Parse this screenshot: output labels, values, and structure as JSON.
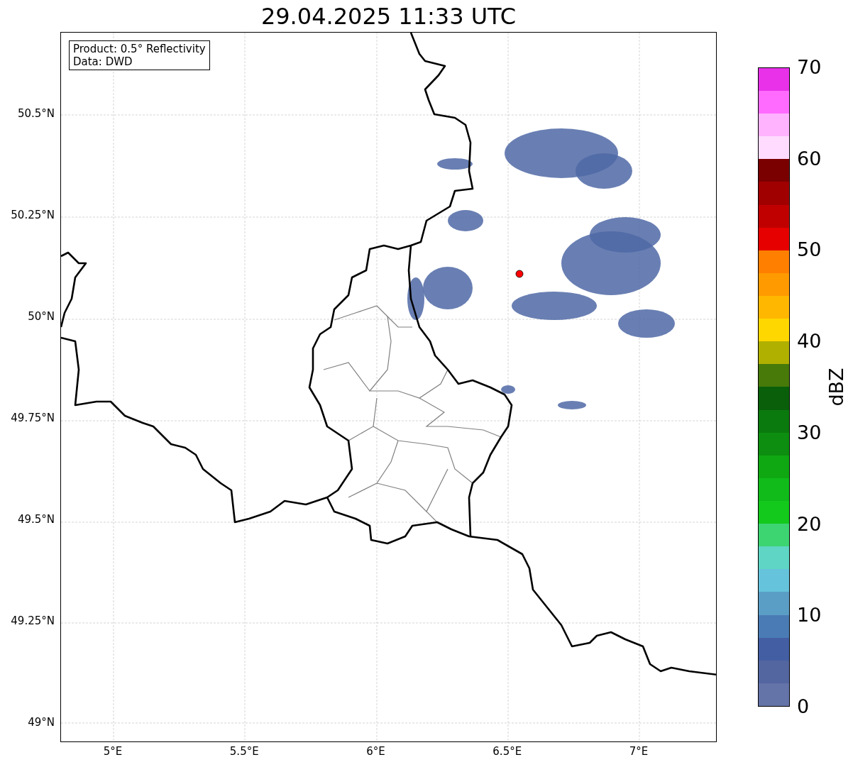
{
  "title": "29.04.2025 11:33 UTC",
  "info_box": {
    "lines": [
      "Product: 0.5° Reflectivity",
      "Data: DWD"
    ]
  },
  "y_ticks": [
    "50.5°N",
    "50.25°N",
    "50°N",
    "49.75°N",
    "49.5°N",
    "49.25°N",
    "49°N"
  ],
  "x_ticks": [
    "5°E",
    "5.5°E",
    "6°E",
    "6.5°E",
    "7°E"
  ],
  "colorbar": {
    "label": "dBZ",
    "ticks": [
      "70",
      "60",
      "50",
      "40",
      "30",
      "20",
      "10",
      "0"
    ],
    "segments": [
      {
        "color": "#6473a8"
      },
      {
        "color": "#5366a0"
      },
      {
        "color": "#445ea3"
      },
      {
        "color": "#4a7bb5"
      },
      {
        "color": "#5a9ec6"
      },
      {
        "color": "#66c3dc"
      },
      {
        "color": "#5fd6c5"
      },
      {
        "color": "#3dd472"
      },
      {
        "color": "#12c91c"
      },
      {
        "color": "#10bb1a"
      },
      {
        "color": "#0fa812"
      },
      {
        "color": "#0d8e10"
      },
      {
        "color": "#0b7a0e"
      },
      {
        "color": "#0a600a"
      },
      {
        "color": "#487a0a"
      },
      {
        "color": "#b0b000"
      },
      {
        "color": "#ffd700"
      },
      {
        "color": "#ffb700"
      },
      {
        "color": "#ff9a00"
      },
      {
        "color": "#ff7f00"
      },
      {
        "color": "#e60000"
      },
      {
        "color": "#c00000"
      },
      {
        "color": "#a00000"
      },
      {
        "color": "#7a0000"
      },
      {
        "color": "#ffdcff"
      },
      {
        "color": "#ffb3ff"
      },
      {
        "color": "#ff6bff"
      },
      {
        "color": "#e831e8"
      }
    ]
  }
}
